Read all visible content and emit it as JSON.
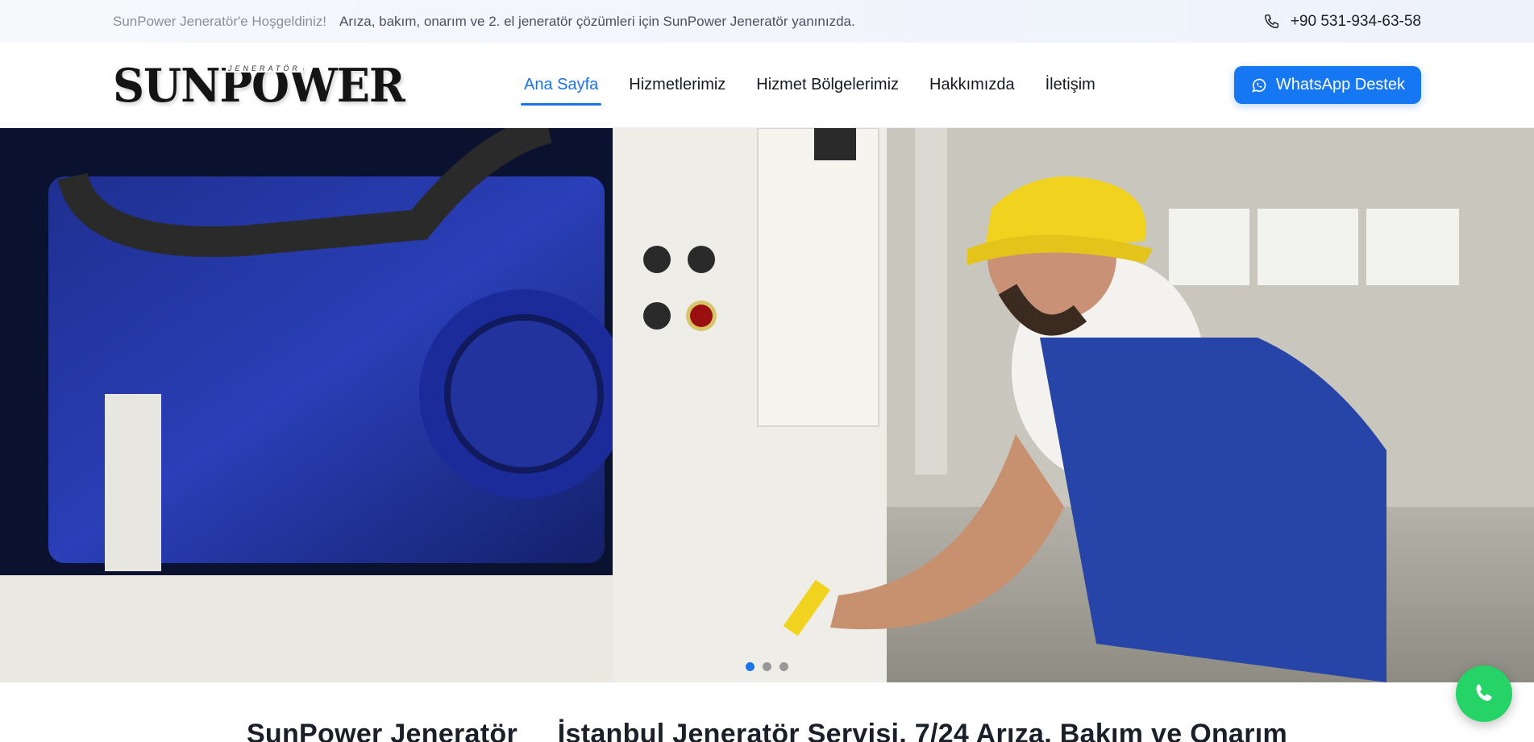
{
  "topbar": {
    "welcome": "SunPower Jeneratör'e Hoşgeldiniz!",
    "tagline": "Arıza, bakım, onarım ve 2. el jeneratör çözümleri için SunPower Jeneratör yanınızda.",
    "phone": "+90 531-934-63-58",
    "phone_icon": "phone-icon"
  },
  "header": {
    "logo_text": "SUNPOWER",
    "logo_sub": "JENERATÖR",
    "nav": [
      {
        "label": "Ana Sayfa",
        "active": true
      },
      {
        "label": "Hizmetlerimiz",
        "active": false
      },
      {
        "label": "Hizmet Bölgelerimiz",
        "active": false
      },
      {
        "label": "Hakkımızda",
        "active": false
      },
      {
        "label": "İletişim",
        "active": false
      }
    ],
    "whatsapp_label": "WhatsApp Destek",
    "accent": "#1677f2"
  },
  "hero": {
    "slides": 3,
    "active_slide": 1
  },
  "section": {
    "title_left": "SunPower Jeneratör",
    "title_right": "İstanbul Jeneratör Servisi, 7/24 Arıza, Bakım ve Onarım"
  },
  "colors": {
    "whatsapp_green": "#25d366",
    "nav_active": "#1a73e8"
  }
}
